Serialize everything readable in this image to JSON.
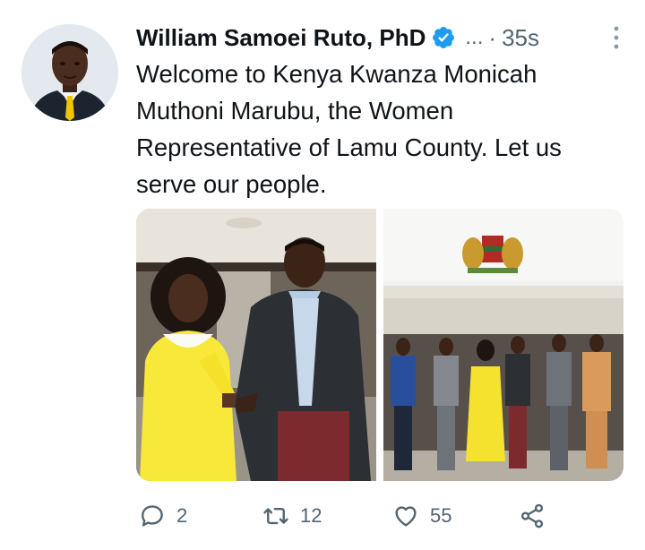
{
  "tweet": {
    "author": {
      "name": "William Samoei Ruto, PhD",
      "verified_icon": "verified-badge-icon",
      "handle": "...",
      "separator": "·",
      "time": "35s"
    },
    "text": "Welcome to Kenya Kwanza Monicah Muthoni Marubu, the Women Representative of Lamu County. Let us serve our people.",
    "media": [
      {
        "icon": "photo-handshake"
      },
      {
        "icon": "photo-group"
      }
    ],
    "actions": {
      "reply": {
        "icon": "reply-icon",
        "count": "2"
      },
      "retweet": {
        "icon": "retweet-icon",
        "count": "12"
      },
      "like": {
        "icon": "heart-icon",
        "count": "55"
      },
      "share": {
        "icon": "share-icon"
      }
    },
    "colors": {
      "accent": "#1d9bf0",
      "secondary_text": "#536471",
      "primary_text": "#0f1419"
    }
  }
}
